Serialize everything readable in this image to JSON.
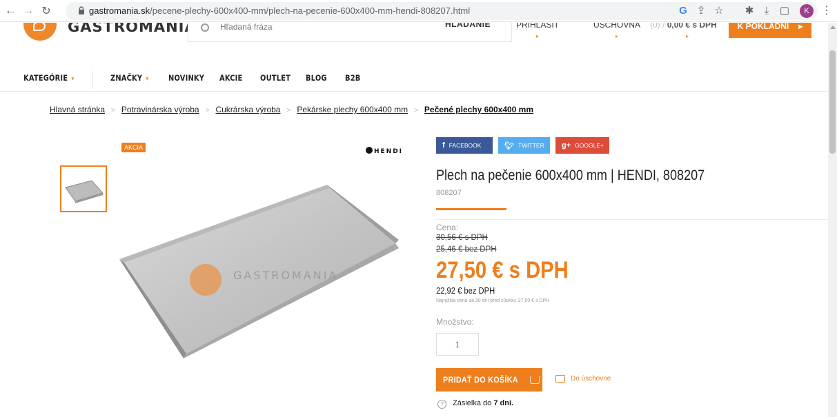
{
  "browser": {
    "url_host": "gastromania.sk",
    "url_path": "/pecene-plechy-600x400-mm/plech-na-pecenie-600x400-mm-hendi-808207.html",
    "avatar_letter": "K"
  },
  "header": {
    "logo_text": "GASTROMANIA",
    "search_placeholder": "Hľadaná fráza",
    "search_button": "HĽADANIE",
    "login": "PRIHLÁSIŤ",
    "favorites": "ÚSCHOVŇA",
    "cart_count": "(0) /",
    "cart_total": "0,00 € s DPH",
    "checkout": "K POKLADNI"
  },
  "nav": {
    "items": [
      "KATEGÓRIE",
      "ZNAČKY",
      "NOVINKY",
      "AKCIE",
      "OUTLET",
      "BLOG",
      "B2B"
    ]
  },
  "breadcrumb": {
    "items": [
      "Hlavná stránka",
      "Potravinárska výroba",
      "Cukrárska výroba",
      "Pekárske plechy 600x400 mm"
    ],
    "current": "Pečené plechy 600x400 mm"
  },
  "gallery": {
    "badge": "AKCIA",
    "brand": "HENDI",
    "watermark": "GASTROMANIA"
  },
  "share": {
    "facebook": "FACEBOOK",
    "twitter": "TWITTER",
    "google": "GOOGLE+"
  },
  "product": {
    "title": "Plech na pečenie 600x400 mm | HENDI, 808207",
    "sku": "808207",
    "price_label": "Cena:",
    "old_price_gross": "30,56 € s DPH",
    "old_price_net": "25,46 € bez DPH",
    "price_gross": "27,50 € s DPH",
    "price_net": "22,92 € bez DPH",
    "lowest_price_note": "Najnižšia cena za 30 dní pred zľavou: 27,50 € s DPH",
    "quantity_label": "Množstvo:",
    "quantity_value": "1",
    "add_to_cart": "PRIDAŤ DO KOŠÍKA",
    "add_to_favorites": "Do úschovne",
    "shipping_prefix": "Zásielka do",
    "shipping_days": "7 dní."
  },
  "colors": {
    "accent": "#ef7e1c",
    "facebook": "#3b5998",
    "twitter": "#55acee",
    "google": "#dd4b39"
  }
}
